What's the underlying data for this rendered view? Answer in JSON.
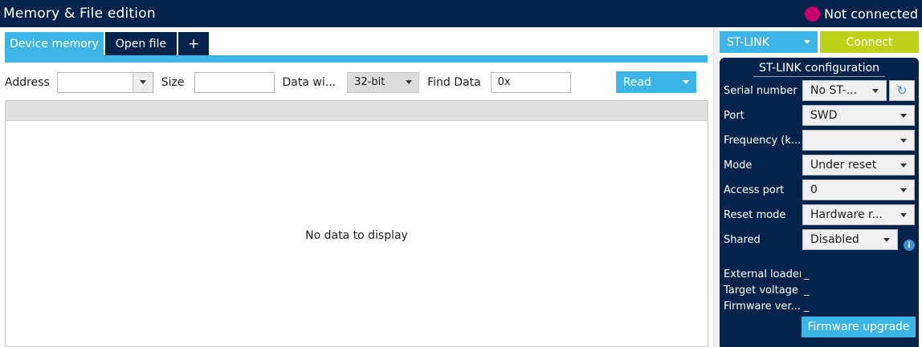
{
  "window": {
    "title": "Memory & File edition",
    "status": "Not connected",
    "status_color": "#c8006e"
  },
  "tabs": [
    {
      "label": "Device memory",
      "active": true
    },
    {
      "label": "Open file",
      "active": false
    },
    {
      "label": "+",
      "active": false
    }
  ],
  "toolbar": {
    "address_label": "Address",
    "address_value": "",
    "size_label": "Size",
    "size_value": "",
    "data_width_label": "Data wi...",
    "data_width_value": "32-bit",
    "find_label": "Find Data",
    "find_value": "0x",
    "read_label": "Read"
  },
  "table": {
    "empty_text": "No data to display"
  },
  "connection": {
    "interface": "ST-LINK",
    "connect_label": "Connect",
    "config_title": "ST-LINK configuration",
    "fields": [
      {
        "label": "Serial number",
        "value": "No ST-..."
      },
      {
        "label": "Port",
        "value": "SWD"
      },
      {
        "label": "Frequency (k...",
        "value": ""
      },
      {
        "label": "Mode",
        "value": "Under reset"
      },
      {
        "label": "Access port",
        "value": "0"
      },
      {
        "label": "Reset mode",
        "value": "Hardware r..."
      },
      {
        "label": "Shared",
        "value": "Disabled"
      }
    ],
    "info": [
      {
        "label": "External loader",
        "value": "_"
      },
      {
        "label": "Target voltage",
        "value": "_"
      },
      {
        "label": "Firmware ver...",
        "value": "_"
      }
    ],
    "firmware_upgrade_label": "Firmware upgrade"
  },
  "colors": {
    "navy": "#03234b",
    "accent_blue": "#3cb4e6",
    "connect_green": "#bdd31a"
  },
  "icons": {
    "refresh": "refresh-icon",
    "info": "info-icon",
    "dropdown": "chevron-down-icon"
  }
}
